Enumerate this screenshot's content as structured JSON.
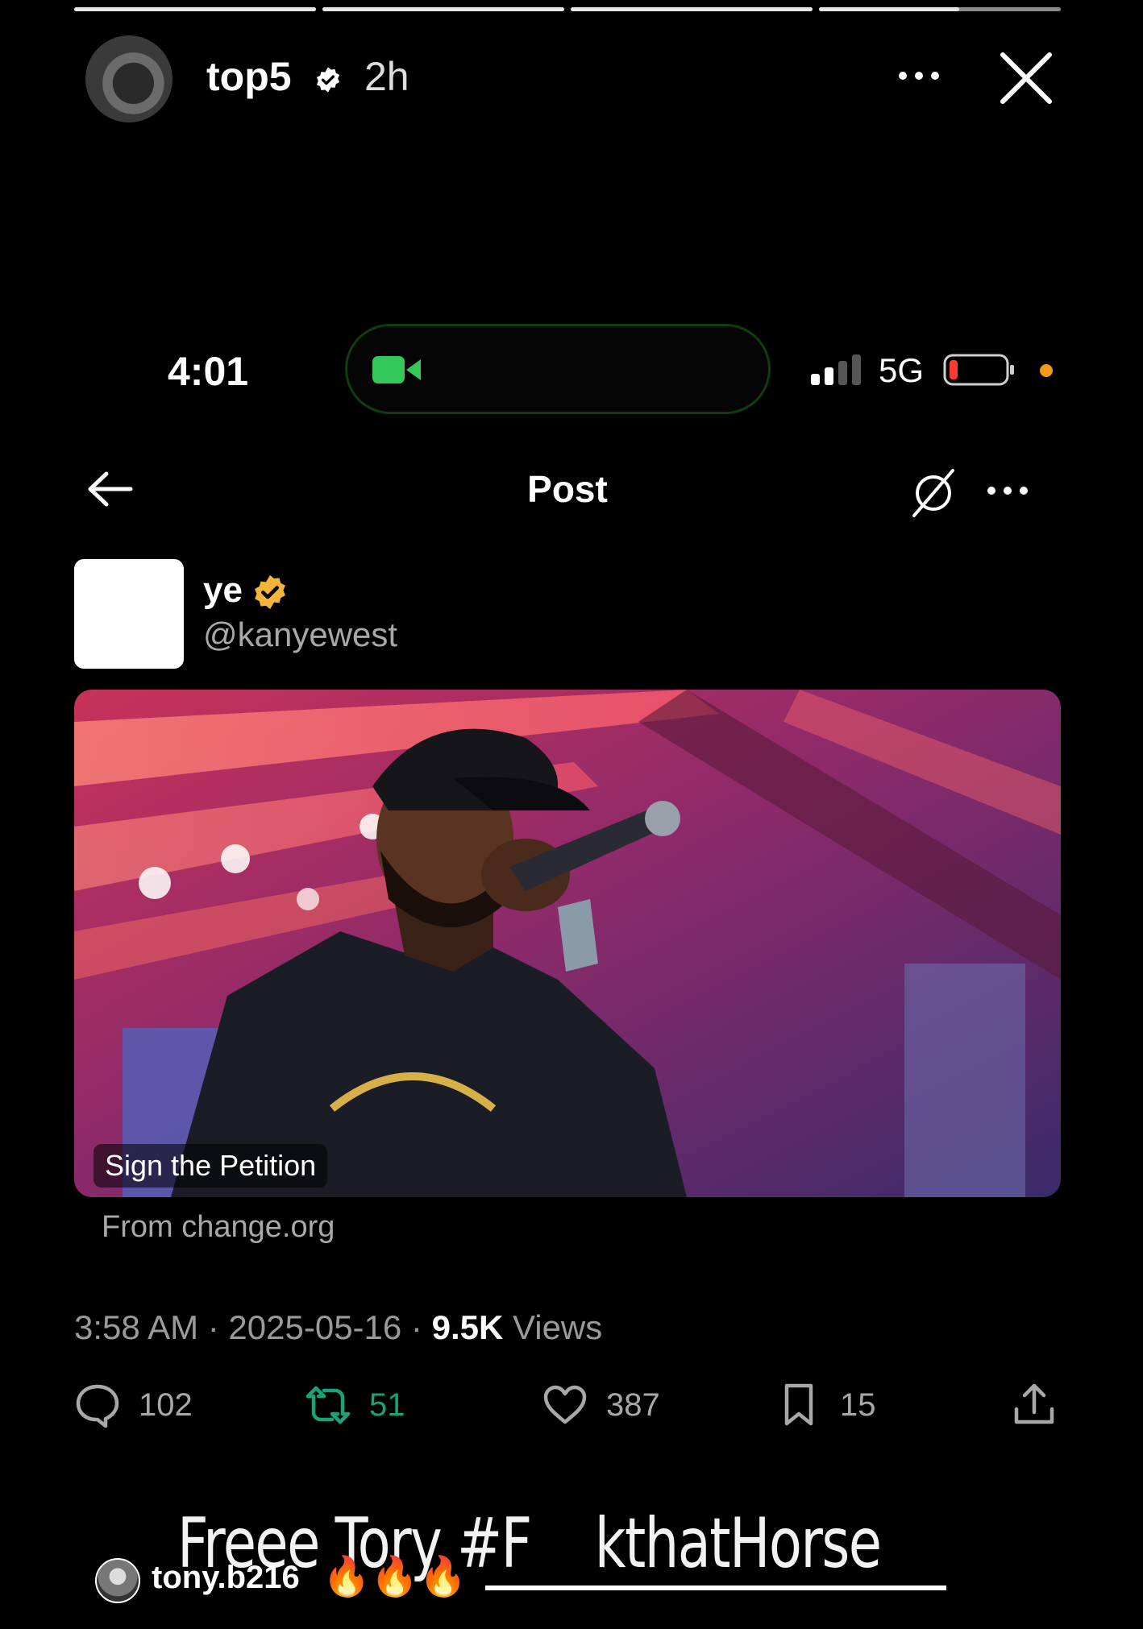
{
  "story": {
    "progress": [
      1,
      1,
      1,
      0.58
    ],
    "username": "top5",
    "time": "2h"
  },
  "status_bar": {
    "time": "4:01",
    "network": "5G"
  },
  "post_nav": {
    "title": "Post"
  },
  "post": {
    "author_name": "ye",
    "author_handle": "@kanyewest",
    "media_tag": "Sign the Petition",
    "source": "From change.org",
    "timestamp": "3:58 AM · 2025-05-16 · ",
    "views_count": "9.5K",
    "views_label": " Views",
    "replies": "102",
    "reposts": "51",
    "likes": "387",
    "bookmarks": "15"
  },
  "caption": {
    "text": "Freee Tory #F    kthatHorse",
    "mention": "tony.b216",
    "emoji": "🔥🔥🔥"
  },
  "colors": {
    "verified_gold": "#f4b53a",
    "repost_green": "#1aa37a",
    "camera_green": "#34c759",
    "battery_red": "#ff3b30"
  }
}
